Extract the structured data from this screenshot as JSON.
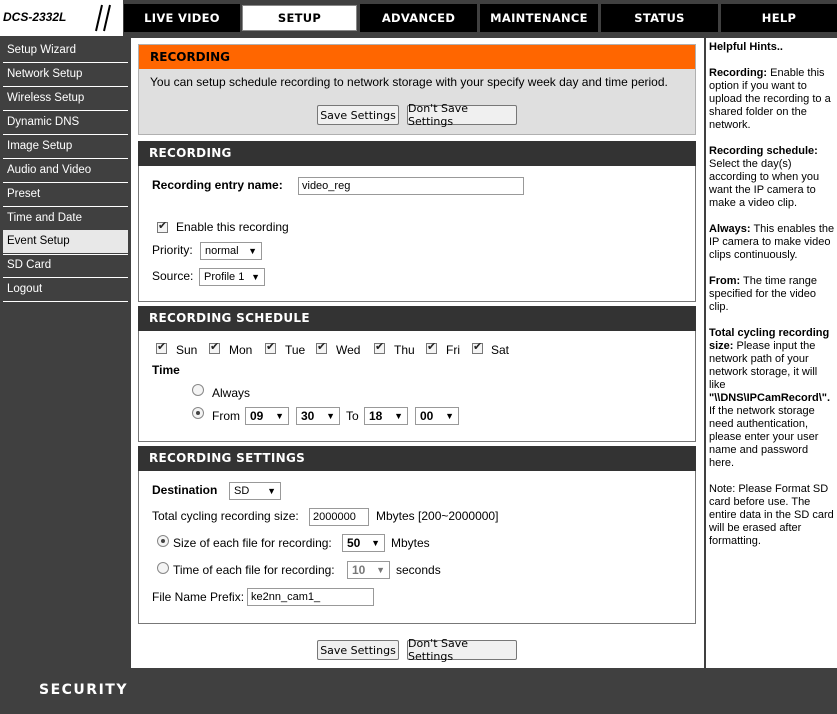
{
  "brand": {
    "model": "DCS-2332L",
    "footer": "SECURITY"
  },
  "nav": {
    "tabs": [
      {
        "label": "LIVE VIDEO"
      },
      {
        "label": "SETUP"
      },
      {
        "label": "ADVANCED"
      },
      {
        "label": "MAINTENANCE"
      },
      {
        "label": "STATUS"
      },
      {
        "label": "HELP"
      }
    ],
    "active": "SETUP"
  },
  "sidebar": {
    "items": [
      {
        "label": "Setup Wizard"
      },
      {
        "label": "Network Setup"
      },
      {
        "label": "Wireless Setup"
      },
      {
        "label": "Dynamic DNS"
      },
      {
        "label": "Image Setup"
      },
      {
        "label": "Audio and Video"
      },
      {
        "label": "Preset"
      },
      {
        "label": "Time and Date"
      },
      {
        "label": "Event Setup"
      },
      {
        "label": "SD Card"
      },
      {
        "label": "Logout"
      }
    ],
    "active": "Event Setup"
  },
  "intro": {
    "title": "RECORDING",
    "text": "You can setup schedule recording to network storage with your specify week day and time period.",
    "save": "Save Settings",
    "dont_save": "Don't Save Settings"
  },
  "recording": {
    "title": "RECORDING",
    "entry_label": "Recording entry name:",
    "entry_value": "video_reg",
    "enable_label": "Enable this recording",
    "enable_checked": true,
    "priority_label": "Priority:",
    "priority_value": "normal",
    "source_label": "Source:",
    "source_value": "Profile 1"
  },
  "schedule": {
    "title": "RECORDING SCHEDULE",
    "days": [
      {
        "label": "Sun",
        "checked": true
      },
      {
        "label": "Mon",
        "checked": true
      },
      {
        "label": "Tue",
        "checked": true
      },
      {
        "label": "Wed",
        "checked": true
      },
      {
        "label": "Thu",
        "checked": true
      },
      {
        "label": "Fri",
        "checked": true
      },
      {
        "label": "Sat",
        "checked": true
      }
    ],
    "time_label": "Time",
    "always_label": "Always",
    "from_label": "From",
    "to_label": "To",
    "from_hour": "09",
    "from_min": "30",
    "to_hour": "18",
    "to_min": "00",
    "selected": "from"
  },
  "settings": {
    "title": "RECORDING SETTINGS",
    "destination_label": "Destination",
    "destination_value": "SD",
    "cycling_label": "Total cycling recording size:",
    "cycling_value": "2000000",
    "cycling_unit": "Mbytes [200~2000000]",
    "size_label": "Size of each file for recording:",
    "size_value": "50",
    "size_unit": "Mbytes",
    "time_label": "Time of each file for recording:",
    "time_value": "10",
    "time_unit": "seconds",
    "prefix_label": "File Name Prefix:",
    "prefix_value": "ke2nn_cam1_",
    "selected": "size"
  },
  "bottom": {
    "save": "Save Settings",
    "dont_save": "Don't Save Settings"
  },
  "hints": {
    "title": "Helpful Hints..",
    "recording_term": "Recording:",
    "recording_text": "Enable this option if you want to upload the recording to a shared folder on the network.",
    "schedule_term": "Recording schedule:",
    "schedule_text": "Select the day(s) according to when you want the IP camera to make a video clip.",
    "always_term": "Always:",
    "always_text": "This enables the IP camera to make video clips continuously.",
    "from_term": "From:",
    "from_text": "The time range specified for the video clip.",
    "cycling_term": "Total cycling recording size:",
    "cycling_text": "Please input the network path of your network storage, it will like",
    "cycling_path": "\"\\\\DNS\\IPCamRecord\\\".",
    "cycling_text2": "If the network storage need authentication, please enter your user name and password here.",
    "note": "Note: Please Format SD card before use. The entire data in the SD card will be erased after formatting."
  }
}
